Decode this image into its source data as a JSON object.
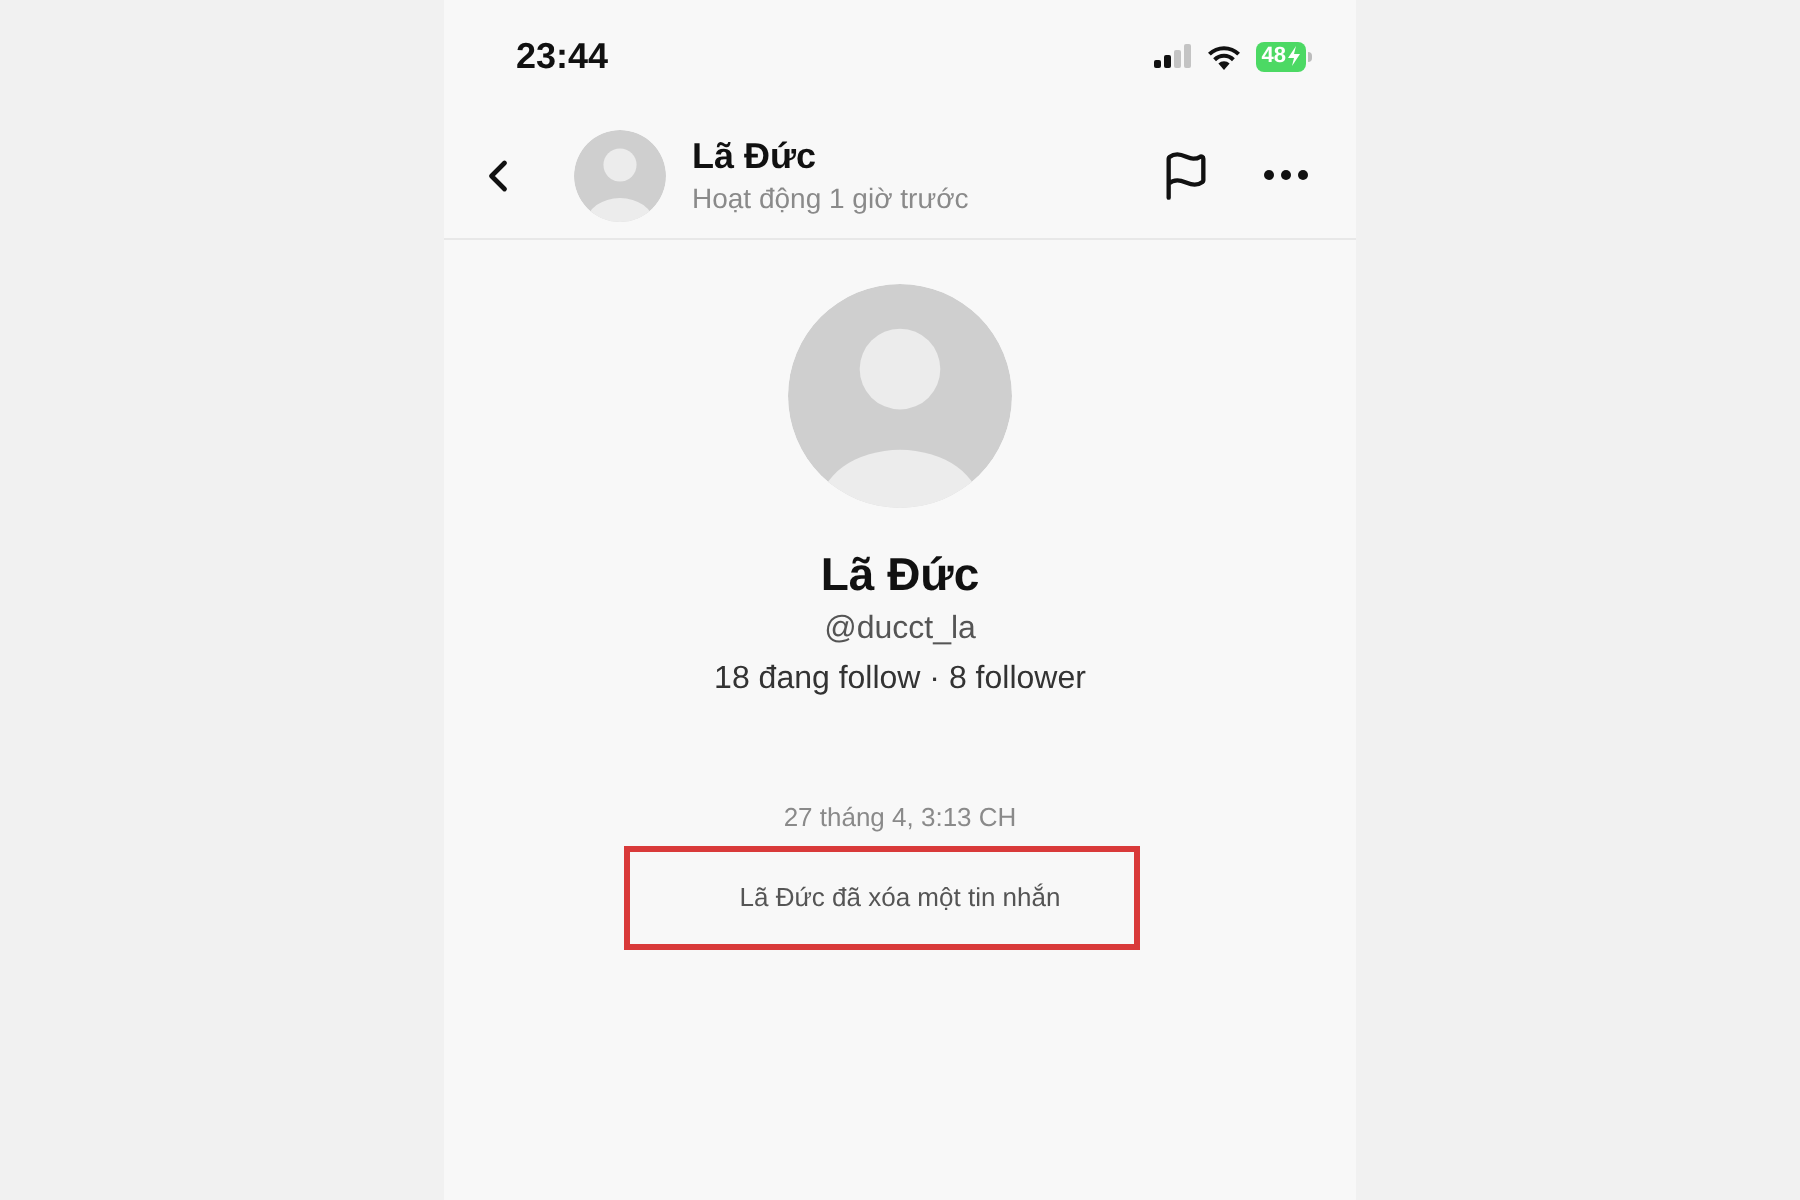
{
  "status_bar": {
    "time": "23:44",
    "battery": "48",
    "charging": true
  },
  "header": {
    "name": "Lã Đức",
    "status": "Hoạt động 1 giờ trước"
  },
  "profile": {
    "name": "Lã Đức",
    "username": "@ducct_la",
    "stats": "18 đang follow · 8 follower"
  },
  "messages": [
    {
      "kind": "timestamp",
      "text": "27 tháng 4, 3:13 CH"
    },
    {
      "kind": "system",
      "text": "Lã Đức đã xóa một tin nhắn",
      "highlighted": true
    }
  ]
}
